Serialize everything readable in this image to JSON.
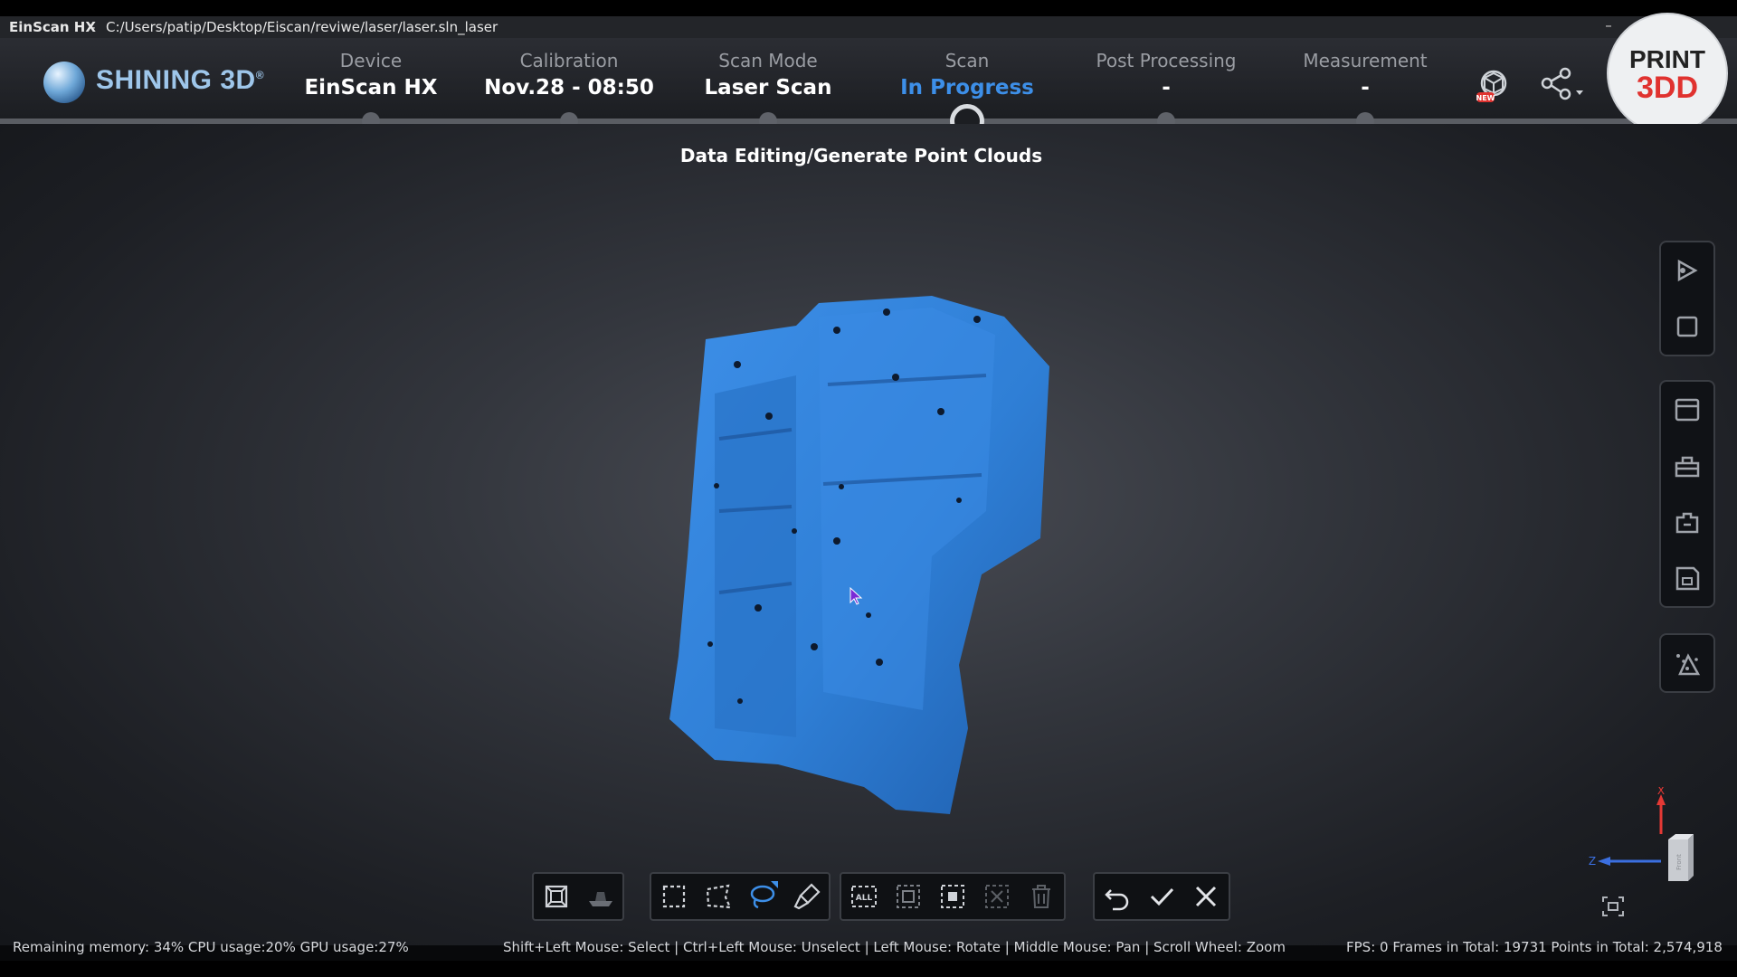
{
  "window": {
    "app_name": "EinScan HX",
    "separator": "-",
    "file_path": "C:/Users/patip/Desktop/Eiscan/reviwe/laser/laser.sln_laser",
    "minimize_glyph": "–"
  },
  "brand": {
    "name": "SHINING 3D",
    "mark": "®"
  },
  "steps": [
    {
      "label": "Device",
      "value": "EinScan HX"
    },
    {
      "label": "Calibration",
      "value": "Nov.28 - 08:50"
    },
    {
      "label": "Scan Mode",
      "value": "Laser Scan"
    },
    {
      "label": "Scan",
      "value": "In Progress",
      "active": true
    },
    {
      "label": "Post Processing",
      "value": "-"
    },
    {
      "label": "Measurement",
      "value": "-"
    }
  ],
  "watermark": {
    "line1": "PRINT",
    "line2": "3DD"
  },
  "header_icons": [
    "new-feature-icon",
    "share-icon"
  ],
  "stage_title": "Data Editing/Generate Point Clouds",
  "sidebar_icons": [
    "play-icon",
    "stop-icon",
    "panel-icon",
    "toolbox-icon",
    "plugin-icon",
    "save-icon",
    "point-cloud-icon"
  ],
  "toolbar": {
    "view": [
      "box-view-icon",
      "plane-icon"
    ],
    "selection": [
      "rect-select-icon",
      "polygon-select-icon",
      "lasso-select-icon",
      "brush-select-icon"
    ],
    "bulk": [
      "select-all-icon",
      "invert-select-icon",
      "select-connected-icon",
      "unselect-icon",
      "delete-icon"
    ],
    "actions": [
      "undo-icon",
      "confirm-icon",
      "cancel-icon"
    ],
    "select_all_text": "ALL"
  },
  "axis_labels": {
    "x": "X",
    "z": "Z",
    "face": "Front"
  },
  "colors": {
    "accent": "#3d8fe8",
    "model": "#2f7fd6",
    "axis_x": "#e53935",
    "axis_z": "#3b6fe0"
  },
  "status": {
    "left": "Remaining memory: 34% CPU usage:20%  GPU usage:27%",
    "middle": "Shift+Left Mouse: Select | Ctrl+Left Mouse: Unselect | Left Mouse: Rotate | Middle Mouse: Pan | Scroll Wheel: Zoom",
    "right": "FPS:  0  Frames in Total: 19731  Points in Total: 2,574,918"
  }
}
